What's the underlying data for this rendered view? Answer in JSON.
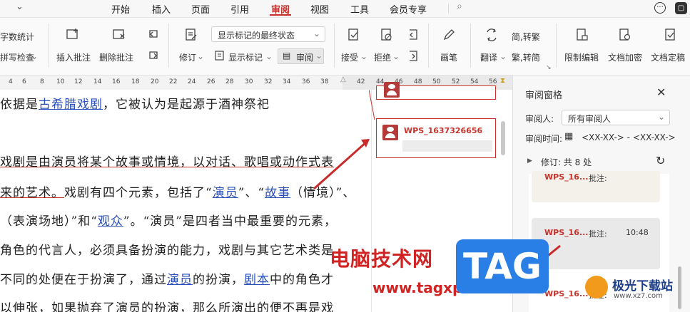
{
  "menu": {
    "items": [
      "开始",
      "插入",
      "页面",
      "引用",
      "审阅",
      "视图",
      "工具",
      "会员专享"
    ],
    "active": "审阅"
  },
  "toolbar": {
    "word_count": "字数统计",
    "spell_check": "拼写检查",
    "insert_comment": "插入批注",
    "delete_comment": "删除批注",
    "track_changes": "修订",
    "display_mode": "显示标记的最终状态",
    "show_markup": "显示标记",
    "review": "审阅",
    "accept": "接受",
    "reject": "拒绝",
    "pen": "画笔",
    "translate": "翻译",
    "trad_to_simp": "简,转繁",
    "simp": "繁,转简",
    "restrict_edit": "限制编辑",
    "doc_encrypt": "文档加密",
    "doc_finalize": "文档定稿"
  },
  "ruler": {
    "ticks": [
      "4",
      "6",
      "8",
      "10",
      "12",
      "14",
      "16",
      "18",
      "20",
      "22",
      "24",
      "26",
      "28",
      "30",
      "32",
      "34",
      "36",
      "38",
      "42",
      "44",
      "46",
      "48",
      "50",
      "52",
      "54",
      "56"
    ]
  },
  "document": {
    "l1_a": "依据是",
    "l1_link": "古希腊戏剧",
    "l1_b": "，它被认为是起源于酒神祭祀",
    "l2": "戏剧是由演员将某个故事或情境，以对话、歌唱或动作式表",
    "l3_a": "来的艺术。",
    "l3_b": "戏剧有四个元素，包括了“",
    "l3_link1": "演员",
    "l3_c": "”、“",
    "l3_link2": "故事",
    "l3_d": "（情境）”、",
    "l4_a": "（表演场地）”和“",
    "l4_link": "观众",
    "l4_b": "”。“演员”是四者当中最重要的元素，",
    "l5": "角色的代言人，必须具备扮演的能力，戏剧与其它艺术类是",
    "l6_a": "不同的处便在于扮演了，通过",
    "l6_link1": "演员",
    "l6_b": "的扮演，",
    "l6_link2": "剧本",
    "l6_c": "中的角色才",
    "l7": "以伸张，如果抛弃了演员的扮演，那么所演出的便不再是戏"
  },
  "comment_card": {
    "user": "WPS_1637326656"
  },
  "review_pane": {
    "title": "审阅窗格",
    "reviewer_label": "审阅人:",
    "reviewer_value": "所有审阅人",
    "time_label": "审阅时间:",
    "time_value": "<XX-XX-> - <XX-XX->",
    "revisions": "修订: 共 8 处",
    "items": [
      {
        "user": "WPS_16...",
        "type": "批注:",
        "time": ""
      },
      {
        "user": "WPS_16...",
        "type": "批注:",
        "time": "10:48"
      },
      {
        "user": "WPS_16...",
        "type": "批注:",
        "time": ""
      }
    ]
  },
  "watermark": {
    "cn": "电脑技术网",
    "url": "www.tagxp.com",
    "tag": "TAG",
    "logo2_text": "极光下载站",
    "logo2_url": "www.xz7.com"
  }
}
